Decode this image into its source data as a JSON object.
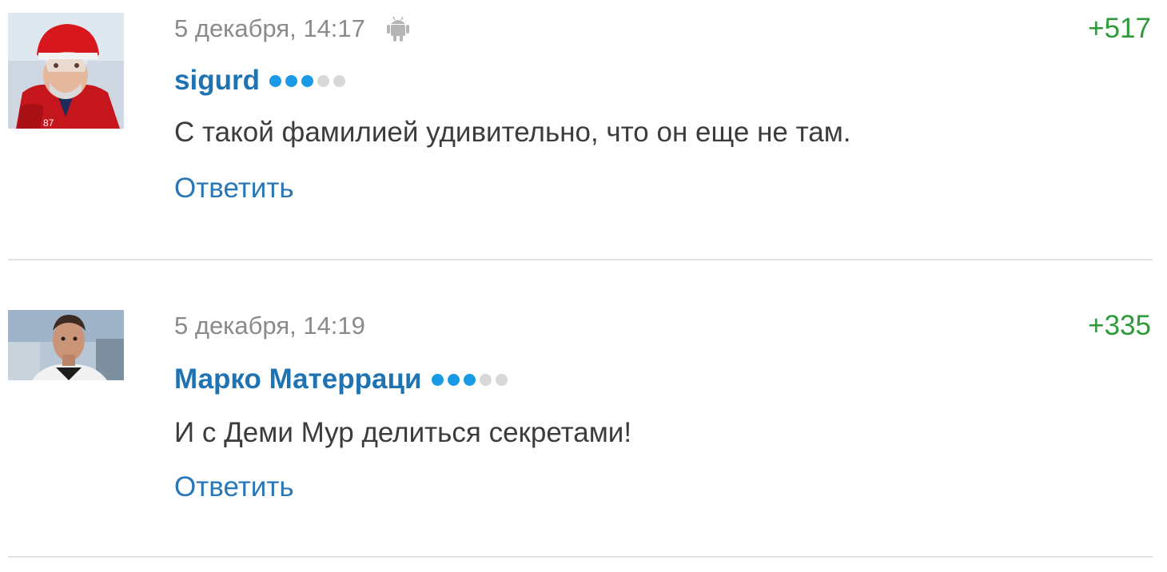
{
  "comments": [
    {
      "date": "5 декабря, 14:17",
      "device_icon": "android-icon",
      "rating": "+517",
      "author": "sigurd",
      "level_dots": {
        "filled": 3,
        "total": 5
      },
      "text": "С такой фамилией удивительно, что он еще не там.",
      "reply_label": "Ответить"
    },
    {
      "date": "5 декабря, 14:19",
      "rating": "+335",
      "author": "Марко Матерраци",
      "level_dots": {
        "filled": 3,
        "total": 5
      },
      "text": "И с Деми Мур делиться секретами!",
      "reply_label": "Ответить"
    }
  ],
  "colors": {
    "author": "#1f73b3",
    "reply": "#2a77b8",
    "rating": "#2e9a3a",
    "date": "#8a8a8a",
    "dot_on": "#1a9ae6",
    "dot_off": "#d8d8d8"
  }
}
